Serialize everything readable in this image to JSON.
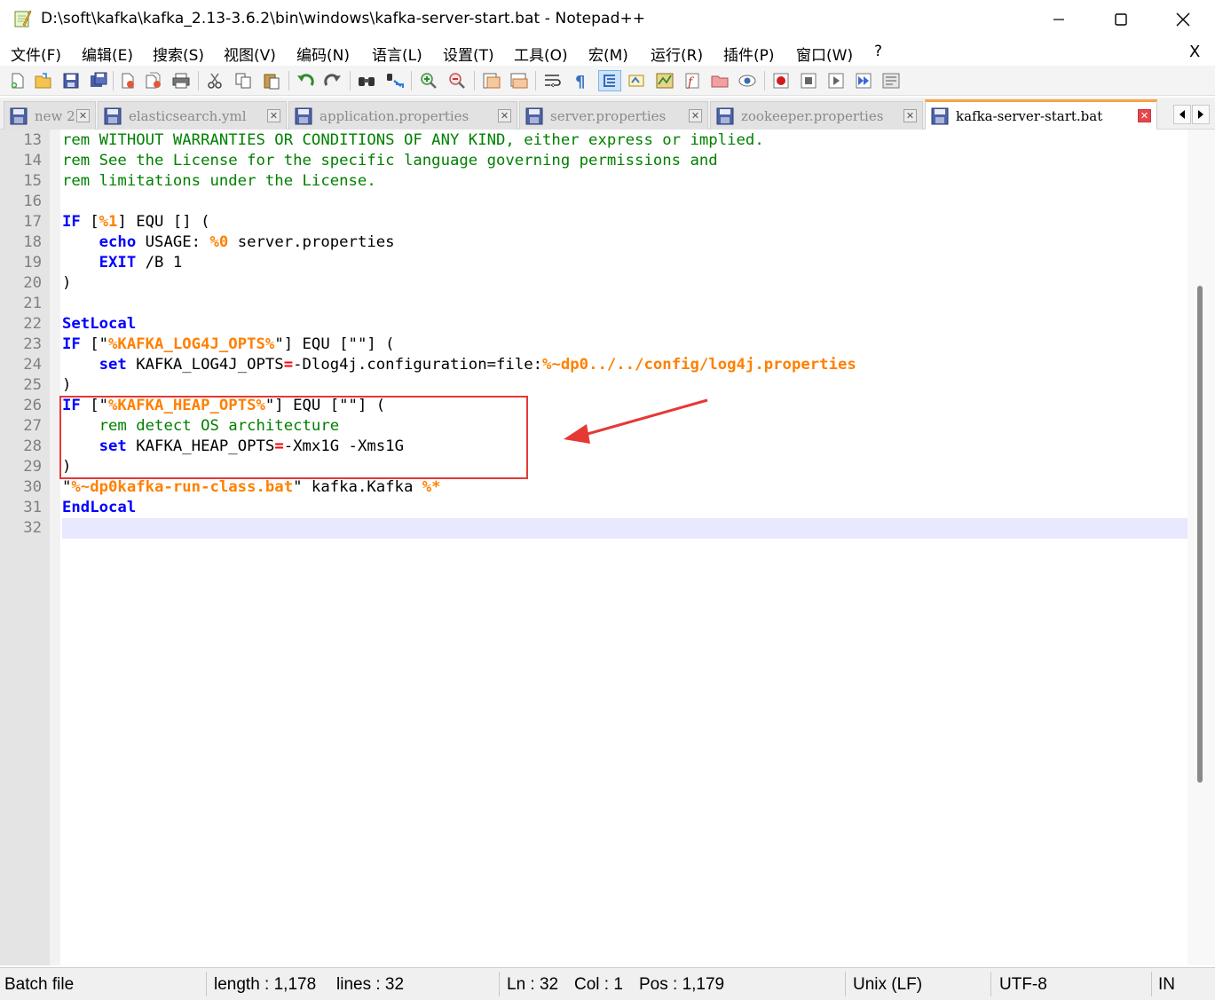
{
  "window": {
    "title": "D:\\soft\\kafka\\kafka_2.13-3.6.2\\bin\\windows\\kafka-server-start.bat - Notepad++"
  },
  "menu": {
    "items": [
      "文件(F)",
      "编辑(E)",
      "搜索(S)",
      "视图(V)",
      "编码(N)",
      "语言(L)",
      "设置(T)",
      "工具(O)",
      "宏(M)",
      "运行(R)",
      "插件(P)",
      "窗口(W)",
      "?"
    ],
    "close_glyph": "X"
  },
  "toolbar": {
    "icons": [
      "new-file-icon",
      "open-file-icon",
      "save-icon",
      "save-all-icon",
      "close-icon",
      "close-all-icon",
      "print-icon",
      "cut-icon",
      "copy-icon",
      "paste-icon",
      "undo-icon",
      "redo-icon",
      "find-icon",
      "replace-icon",
      "zoom-in-icon",
      "zoom-out-icon",
      "sync-vertical-icon",
      "sync-horizontal-icon",
      "word-wrap-icon",
      "show-all-chars-icon",
      "indent-guide-icon",
      "user-language-icon",
      "doc-map-icon",
      "function-list-icon",
      "folder-workspace-icon",
      "monitoring-icon",
      "record-macro-icon",
      "stop-macro-icon",
      "play-macro-icon",
      "run-macro-multiple-icon",
      "save-macro-icon"
    ]
  },
  "tabs": [
    {
      "label": "new 2",
      "active": false
    },
    {
      "label": "elasticsearch.yml",
      "active": false
    },
    {
      "label": "application.properties",
      "active": false
    },
    {
      "label": "server.properties",
      "active": false
    },
    {
      "label": "zookeeper.properties",
      "active": false
    },
    {
      "label": "kafka-server-start.bat",
      "active": true
    }
  ],
  "tab_close_glyph": "✕",
  "editor": {
    "current_line": 32,
    "lines": [
      {
        "n": "13",
        "tokens": [
          [
            "c-comment",
            "rem WITHOUT WARRANTIES OR CONDITIONS OF ANY KIND, either express or implied."
          ]
        ]
      },
      {
        "n": "14",
        "tokens": [
          [
            "c-comment",
            "rem See the License for the specific language governing permissions and"
          ]
        ]
      },
      {
        "n": "15",
        "tokens": [
          [
            "c-comment",
            "rem limitations under the License."
          ]
        ]
      },
      {
        "n": "16",
        "tokens": []
      },
      {
        "n": "17",
        "tokens": [
          [
            "c-kw",
            "IF"
          ],
          [
            "c-txt",
            " ["
          ],
          [
            "c-var",
            "%1"
          ],
          [
            "c-txt",
            "] EQU [] ("
          ]
        ]
      },
      {
        "n": "18",
        "tokens": [
          [
            "c-txt",
            "    "
          ],
          [
            "c-kw",
            "echo"
          ],
          [
            "c-txt",
            " USAGE: "
          ],
          [
            "c-var",
            "%0"
          ],
          [
            "c-txt",
            " server.properties"
          ]
        ]
      },
      {
        "n": "19",
        "tokens": [
          [
            "c-txt",
            "    "
          ],
          [
            "c-kw",
            "EXIT"
          ],
          [
            "c-txt",
            " /B 1"
          ]
        ]
      },
      {
        "n": "20",
        "tokens": [
          [
            "c-txt",
            ")"
          ]
        ]
      },
      {
        "n": "21",
        "tokens": []
      },
      {
        "n": "22",
        "tokens": [
          [
            "c-kw",
            "SetLocal"
          ]
        ]
      },
      {
        "n": "23",
        "tokens": [
          [
            "c-kw",
            "IF"
          ],
          [
            "c-txt",
            " [\""
          ],
          [
            "c-var",
            "%KAFKA_LOG4J_OPTS%"
          ],
          [
            "c-txt",
            "\"] EQU [\"\"] ("
          ]
        ]
      },
      {
        "n": "24",
        "tokens": [
          [
            "c-txt",
            "    "
          ],
          [
            "c-kw",
            "set"
          ],
          [
            "c-txt",
            " KAFKA_LOG4J_OPTS"
          ],
          [
            "c-op",
            "="
          ],
          [
            "c-txt",
            "-Dlog4j.configuration=file:"
          ],
          [
            "c-var",
            "%~dp0../../config/log4j.properties"
          ]
        ]
      },
      {
        "n": "25",
        "tokens": [
          [
            "c-txt",
            ")"
          ]
        ]
      },
      {
        "n": "26",
        "tokens": [
          [
            "c-kw",
            "IF"
          ],
          [
            "c-txt",
            " [\""
          ],
          [
            "c-var",
            "%KAFKA_HEAP_OPTS%"
          ],
          [
            "c-txt",
            "\"] EQU [\"\"] ("
          ]
        ]
      },
      {
        "n": "27",
        "tokens": [
          [
            "c-txt",
            "    "
          ],
          [
            "c-comment",
            "rem detect OS architecture"
          ]
        ]
      },
      {
        "n": "28",
        "tokens": [
          [
            "c-txt",
            "    "
          ],
          [
            "c-kw",
            "set"
          ],
          [
            "c-txt",
            " KAFKA_HEAP_OPTS"
          ],
          [
            "c-op",
            "="
          ],
          [
            "c-txt",
            "-Xmx1G -Xms1G"
          ]
        ]
      },
      {
        "n": "29",
        "tokens": [
          [
            "c-txt",
            ")"
          ]
        ]
      },
      {
        "n": "30",
        "tokens": [
          [
            "c-txt",
            "\""
          ],
          [
            "c-var",
            "%~dp0kafka-run-class.bat"
          ],
          [
            "c-txt",
            "\" kafka.Kafka "
          ],
          [
            "c-var",
            "%*"
          ]
        ]
      },
      {
        "n": "31",
        "tokens": [
          [
            "c-kw",
            "EndLocal"
          ]
        ]
      },
      {
        "n": "32",
        "tokens": []
      }
    ]
  },
  "status": {
    "language": "Batch file",
    "length": "length : 1,178",
    "lines": "lines : 32",
    "ln": "Ln : 32",
    "col": "Col : 1",
    "pos": "Pos : 1,179",
    "eol": "Unix (LF)",
    "encoding": "UTF-8",
    "mode": "IN"
  },
  "colors": {
    "comment": "#008000",
    "keyword": "#0000ff",
    "variable": "#ff8000",
    "operator": "#ff0000",
    "annotation": "#e53935",
    "active_tab_accent": "#f7a442"
  }
}
